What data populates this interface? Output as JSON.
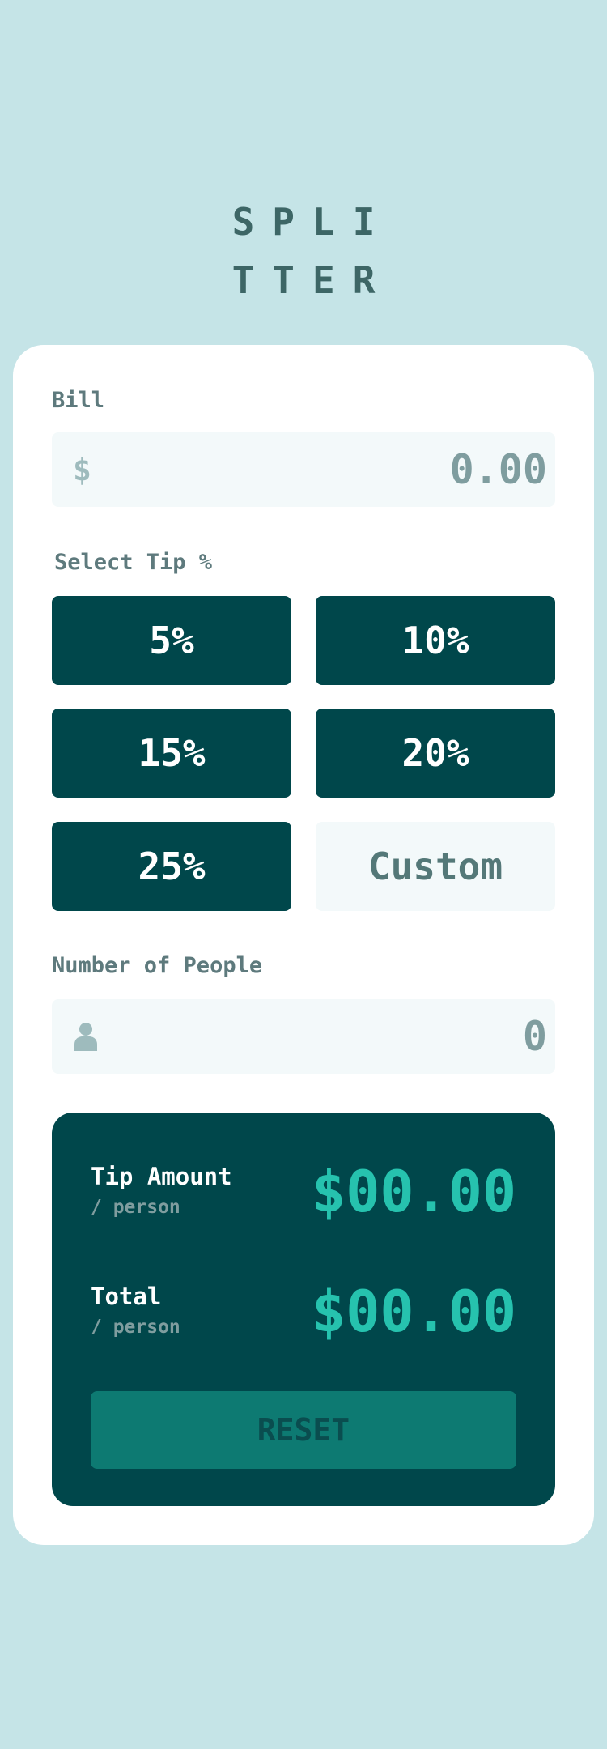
{
  "app": {
    "logo_line1": "SPLI",
    "logo_line2": "TTER"
  },
  "bill": {
    "label": "Bill",
    "prefix": "$",
    "value": "0.00"
  },
  "tip": {
    "label": "Select Tip %",
    "options": [
      {
        "label": "5%"
      },
      {
        "label": "10%"
      },
      {
        "label": "15%"
      },
      {
        "label": "20%"
      },
      {
        "label": "25%"
      }
    ],
    "custom_label": "Custom"
  },
  "people": {
    "label": "Number of People",
    "icon": "person-icon",
    "value": "0"
  },
  "results": {
    "tip_amount": {
      "label": "Tip Amount",
      "sub": "/ person",
      "value": "$00.00"
    },
    "total": {
      "label": "Total",
      "sub": "/ person",
      "value": "$00.00"
    },
    "reset_label": "RESET"
  },
  "colors": {
    "background": "#c5e4e7",
    "primary": "#00474b",
    "accent": "#26c2ae",
    "reset": "#0d7a72"
  }
}
